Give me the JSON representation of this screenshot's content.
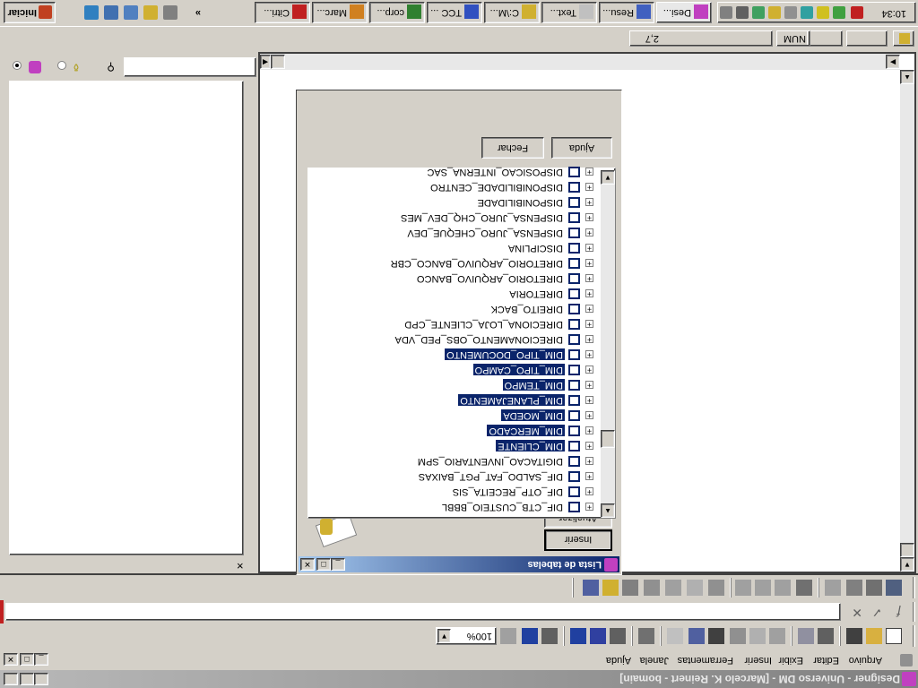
{
  "window": {
    "title": "Designer - Universo DM - [Marcelo K. Reinert - bomain]",
    "menu": [
      "Arquivo",
      "Editar",
      "Exibir",
      "Inserir",
      "Ferramentas",
      "Janela",
      "Ajuda"
    ]
  },
  "toolbar": {
    "zoom": "100%"
  },
  "status": {
    "num": "NUM",
    "coords": "2,7"
  },
  "dialog": {
    "title": "Lista de tabelas",
    "insert_label": "Inserir",
    "update_label": "Atualizar",
    "close_label": "Fechar",
    "help_label": "Ajuda",
    "tables": [
      {
        "name": "DIF_CTB_CUSTEIO_BBBL",
        "selected": false
      },
      {
        "name": "DIF_OTP_RECEITA_SIS",
        "selected": false
      },
      {
        "name": "DIF_SALDO_FAT_PGT_BAIXAS",
        "selected": false
      },
      {
        "name": "DIGITACAO_INVENTARIO_SPM",
        "selected": false
      },
      {
        "name": "DIM_CLIENTE",
        "selected": true
      },
      {
        "name": "DIM_MERCADO",
        "selected": true
      },
      {
        "name": "DIM_MOEDA",
        "selected": true
      },
      {
        "name": "DIM_PLANEJAMENTO",
        "selected": true
      },
      {
        "name": "DIM_TEMPO",
        "selected": true
      },
      {
        "name": "DIM_TIPO_CAMPO",
        "selected": true
      },
      {
        "name": "DIM_TIPO_DOCUMENTO",
        "selected": true
      },
      {
        "name": "DIRECIONAMENTO_OBS_PED_VDA",
        "selected": false
      },
      {
        "name": "DIRECIONA_LOJA_CLIENTE_CPD",
        "selected": false
      },
      {
        "name": "DIREITO_BACK",
        "selected": false
      },
      {
        "name": "DIRETORIA",
        "selected": false
      },
      {
        "name": "DIRETORIO_ARQUIVO_BANCO",
        "selected": false
      },
      {
        "name": "DIRETORIO_ARQUIVO_BANCO_CBR",
        "selected": false
      },
      {
        "name": "DISCIPLINA",
        "selected": false
      },
      {
        "name": "DISPENSA_JURO_CHEQUE_DEV",
        "selected": false
      },
      {
        "name": "DISPENSA_JURO_CHQ_DEV_MES",
        "selected": false
      },
      {
        "name": "DISPONIBILIDADE",
        "selected": false
      },
      {
        "name": "DISPONIBILIDADE_CENTRO",
        "selected": false
      },
      {
        "name": "DISPOSICAO_INTERNA_SAC",
        "selected": false
      }
    ]
  },
  "taskbar": {
    "start_label": "Iniciar",
    "clock": "10:34",
    "tasks": [
      {
        "label": "Desi...",
        "icon_color": "#c040c0",
        "active": true
      },
      {
        "label": "Resu...",
        "icon_color": "#4060c0",
        "active": false
      },
      {
        "label": "Text...",
        "icon_color": "#c0c0c0",
        "active": false
      },
      {
        "label": "C:\\M...",
        "icon_color": "#d0b030",
        "active": false
      },
      {
        "label": "TCC ...",
        "icon_color": "#3050c0",
        "active": false
      },
      {
        "label": "corp...",
        "icon_color": "#308030",
        "active": false
      },
      {
        "label": "Marc...",
        "icon_color": "#d08020",
        "active": false
      },
      {
        "label": "Citri...",
        "icon_color": "#c02020",
        "active": false
      }
    ]
  },
  "colors": {
    "selection": "#0a246a",
    "face": "#d4d0c8"
  }
}
